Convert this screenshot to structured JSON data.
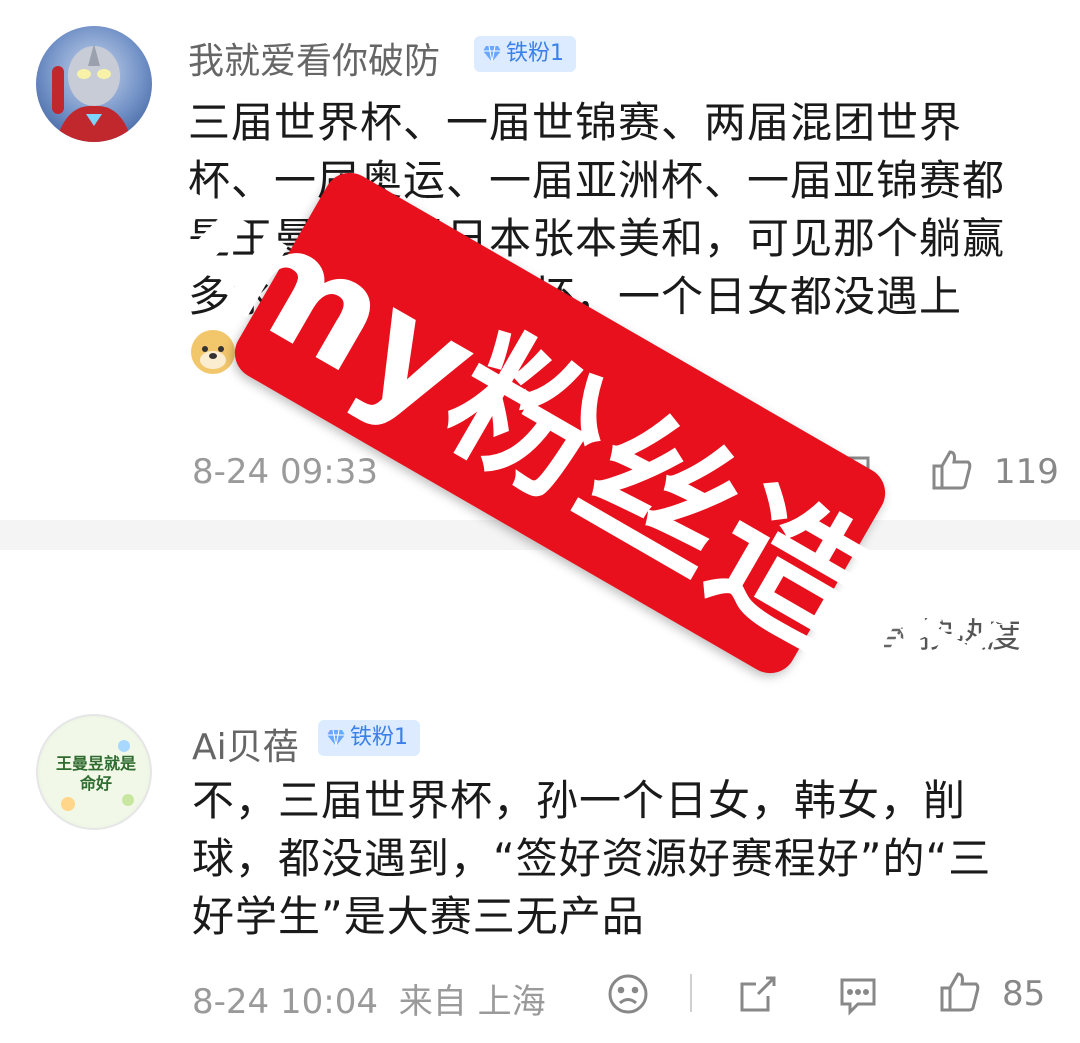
{
  "comments": [
    {
      "username": "我就爱看你破防",
      "badge": "铁粉1",
      "lines": [
        "三届世界杯、一届世锦赛、两届混团世界",
        "杯、一届奥运、一届亚洲杯、一届亚锦赛都",
        "是王曼昱扫雷日本张本美和，可见那个躺赢",
        "多水，她三届世界杯，一个日女都没遇上"
      ],
      "time": "8-24 09:33",
      "likes": "119"
    },
    {
      "username": "Ai贝蓓",
      "badge": "铁粉1",
      "avatar_text": "王曼昱就是命好",
      "lines": [
        "不，三届世界杯，孙一个日女，韩女，削",
        "球，都没遇到，“签好资源好赛程好”的“三",
        "好学生”是大赛三无产品"
      ],
      "time": "8-24 10:04",
      "location": "来自 上海",
      "likes": "85"
    }
  ],
  "sort_label": "按热度",
  "stamp_text": "wmy粉丝造谣",
  "colors": {
    "stamp": "#e8101c",
    "badge_bg": "#dcebff",
    "badge_text": "#3b80e8"
  }
}
